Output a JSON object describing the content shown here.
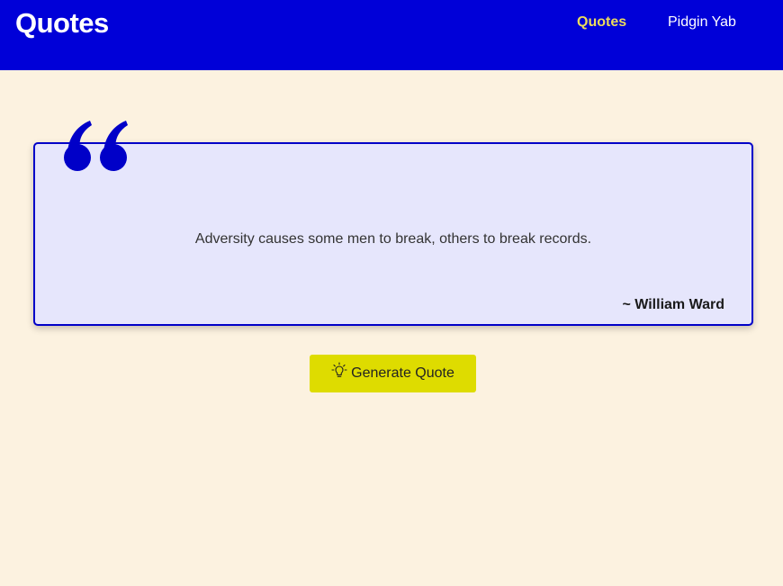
{
  "header": {
    "brand": "Quotes",
    "nav": {
      "quotes_label": "Quotes",
      "pidgin_label": "Pidgin Yab"
    }
  },
  "quote": {
    "mark_icon": "quote-mark-icon",
    "text": "Adversity causes some men to break, others to break records.",
    "author": "~ William Ward"
  },
  "actions": {
    "generate_icon": "lightbulb-icon",
    "generate_label": "Generate Quote"
  },
  "colors": {
    "header_bg": "#0000d8",
    "page_bg": "#fcf2e0",
    "card_bg": "#e6e6fc",
    "card_border": "#0000c8",
    "active_nav": "#ecdc5c",
    "button_bg": "#dedc00"
  }
}
